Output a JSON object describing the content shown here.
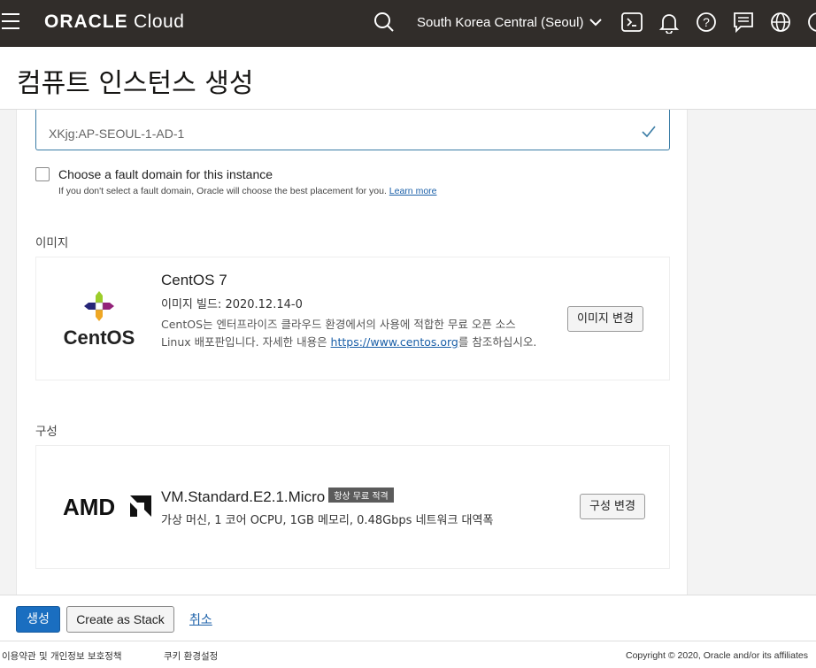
{
  "header": {
    "brand": "ORACLE",
    "product": "Cloud",
    "region": "South Korea Central (Seoul)",
    "icons": [
      "menu-icon",
      "search-icon",
      "chevron-down-icon",
      "cloud-shell-icon",
      "bell-icon",
      "help-icon",
      "chat-icon",
      "globe-icon",
      "user-icon"
    ]
  },
  "page": {
    "title": "컴퓨트 인스턴스 생성"
  },
  "availability_domain": {
    "value": "XKjg:AP-SEOUL-1-AD-1"
  },
  "fault_domain": {
    "checkbox_label": "Choose a fault domain for this instance",
    "help_text": "If you don't select a fault domain, Oracle will choose the best placement for you.",
    "learn_more": "Learn more",
    "checked": false
  },
  "image": {
    "section_label": "이미지",
    "logo_text": "CentOS",
    "name": "CentOS 7",
    "build": "이미지 빌드: 2020.12.14-0",
    "desc_before_link": "CentOS는 엔터프라이즈 클라우드 환경에서의 사용에 적합한 무료 오픈 소스 Linux 배포판입니다. 자세한 내용은 ",
    "desc_link": "https://www.centos.org",
    "desc_after_link": "를 참조하십시오.",
    "change_button": "이미지 변경"
  },
  "shape": {
    "section_label": "구성",
    "logo_text": "AMD",
    "name": "VM.Standard.E2.1.Micro",
    "badge": "항상 무료 적격",
    "details": "가상 머신, 1 코어 OCPU, 1GB 메모리, 0.48Gbps 네트워크 대역폭",
    "change_button": "구성 변경"
  },
  "actions": {
    "create": "생성",
    "create_stack": "Create as Stack",
    "cancel": "취소"
  },
  "footer": {
    "terms": "이용약관 및 개인정보 보호정책",
    "cookies": "쿠키 환경설정",
    "copyright": "Copyright © 2020, Oracle and/or its affiliates"
  },
  "colors": {
    "topbar": "#312d2a",
    "primary": "#1a6ec0",
    "link": "#1a5fa8"
  }
}
